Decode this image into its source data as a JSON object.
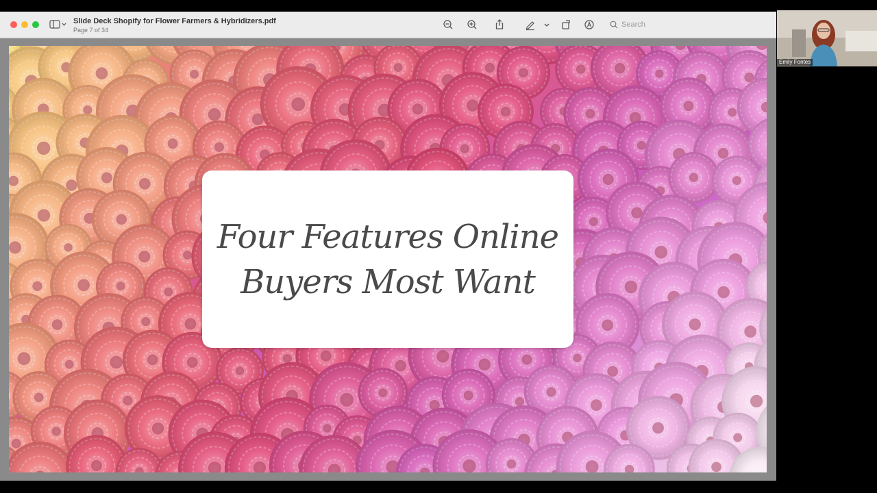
{
  "window": {
    "title": "Slide Deck Shopify for Flower Farmers & Hybridizers.pdf",
    "page_indicator": "Page 7 of 34"
  },
  "toolbar": {
    "icons": [
      "sidebar-toggle-icon",
      "zoom-out-icon",
      "zoom-in-icon",
      "share-icon",
      "markup-pen-icon",
      "chevron-down-icon",
      "rotate-icon",
      "annotate-icon",
      "search-icon"
    ],
    "search_placeholder": "Search"
  },
  "slide": {
    "line1": "Four Features Online",
    "line2": "Buyers Most Want"
  },
  "video": {
    "participant_name": "Emily Fontes"
  },
  "colors": {
    "titlebar": "#ececec",
    "content_bg": "#8a8a8a",
    "card_bg": "#ffffff",
    "text": "#4a4a4a"
  }
}
